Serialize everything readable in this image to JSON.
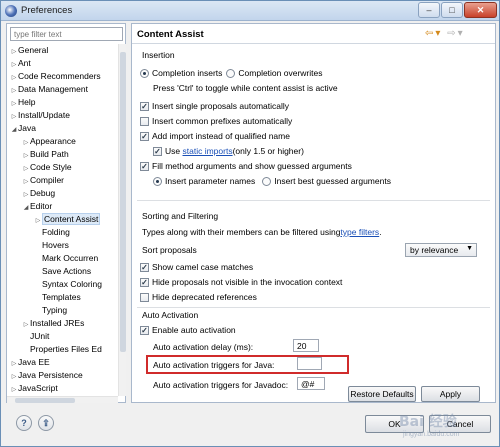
{
  "window": {
    "title": "Preferences",
    "buttons": {
      "minimize": "–",
      "maximize": "□",
      "close": "✕"
    }
  },
  "left": {
    "filter_placeholder": "type filter text",
    "tree": [
      {
        "label": "General",
        "level": 0,
        "twisty": "▷"
      },
      {
        "label": "Ant",
        "level": 0,
        "twisty": "▷"
      },
      {
        "label": "Code Recommenders",
        "level": 0,
        "twisty": "▷"
      },
      {
        "label": "Data Management",
        "level": 0,
        "twisty": "▷"
      },
      {
        "label": "Help",
        "level": 0,
        "twisty": "▷"
      },
      {
        "label": "Install/Update",
        "level": 0,
        "twisty": "▷"
      },
      {
        "label": "Java",
        "level": 0,
        "twisty": "◢"
      },
      {
        "label": "Appearance",
        "level": 1,
        "twisty": "▷"
      },
      {
        "label": "Build Path",
        "level": 1,
        "twisty": "▷"
      },
      {
        "label": "Code Style",
        "level": 1,
        "twisty": "▷"
      },
      {
        "label": "Compiler",
        "level": 1,
        "twisty": "▷"
      },
      {
        "label": "Debug",
        "level": 1,
        "twisty": "▷"
      },
      {
        "label": "Editor",
        "level": 1,
        "twisty": "◢"
      },
      {
        "label": "Content Assist",
        "level": 2,
        "twisty": "▷",
        "selected": true
      },
      {
        "label": "Folding",
        "level": 2,
        "twisty": ""
      },
      {
        "label": "Hovers",
        "level": 2,
        "twisty": ""
      },
      {
        "label": "Mark Occurren",
        "level": 2,
        "twisty": ""
      },
      {
        "label": "Save Actions",
        "level": 2,
        "twisty": ""
      },
      {
        "label": "Syntax Coloring",
        "level": 2,
        "twisty": ""
      },
      {
        "label": "Templates",
        "level": 2,
        "twisty": ""
      },
      {
        "label": "Typing",
        "level": 2,
        "twisty": ""
      },
      {
        "label": "Installed JREs",
        "level": 1,
        "twisty": "▷"
      },
      {
        "label": "JUnit",
        "level": 1,
        "twisty": ""
      },
      {
        "label": "Properties Files Ed",
        "level": 1,
        "twisty": ""
      },
      {
        "label": "Java EE",
        "level": 0,
        "twisty": "▷"
      },
      {
        "label": "Java Persistence",
        "level": 0,
        "twisty": "▷"
      },
      {
        "label": "JavaScript",
        "level": 0,
        "twisty": "▷"
      }
    ]
  },
  "right": {
    "title": "Content Assist",
    "nav": {
      "back": "⇦",
      "back_menu": "▾",
      "forward": "⇨",
      "forward_menu": "▾"
    },
    "insertion": {
      "heading": "Insertion",
      "completion_inserts": "Completion inserts",
      "completion_overwrites": "Completion overwrites",
      "hint": "Press 'Ctrl' to toggle while content assist is active",
      "insert_single": "Insert single proposals automatically",
      "insert_common": "Insert common prefixes automatically",
      "add_import": "Add import instead of qualified name",
      "use_prefix": "Use ",
      "static_imports": "static imports",
      "use_suffix": " (only 1.5 or higher)",
      "fill_method": "Fill method arguments and show guessed arguments",
      "insert_param_names": "Insert parameter names",
      "insert_best_guessed": "Insert best guessed arguments"
    },
    "sorting": {
      "heading": "Sorting and Filtering",
      "types_text": "Types along with their members can be filtered using ",
      "type_filters": "type filters",
      "types_end": ".",
      "sort_proposals": "Sort proposals",
      "sort_value": "by relevance",
      "show_camel": "Show camel case matches",
      "hide_not_visible": "Hide proposals not visible in the invocation context",
      "hide_deprecated": "Hide deprecated references"
    },
    "auto": {
      "heading": "Auto Activation",
      "enable": "Enable auto activation",
      "delay_label": "Auto activation delay (ms):",
      "delay_value": "20",
      "java_label": "Auto activation triggers for Java:",
      "java_value": "",
      "javadoc_label": "Auto activation triggers for Javadoc:",
      "javadoc_value": "@#"
    },
    "restore_defaults": "Restore Defaults",
    "apply": "Apply"
  },
  "footer": {
    "help_icon": "?",
    "import_icon": "⇪",
    "ok": "OK",
    "cancel": "Cancel",
    "watermark": "Bai 经验",
    "watermark_sub": "jingyan.baidu.com"
  },
  "colors": {
    "link": "#1a4fb6",
    "highlight_box": "#d02b2b",
    "selection": "#ddeaf8"
  }
}
